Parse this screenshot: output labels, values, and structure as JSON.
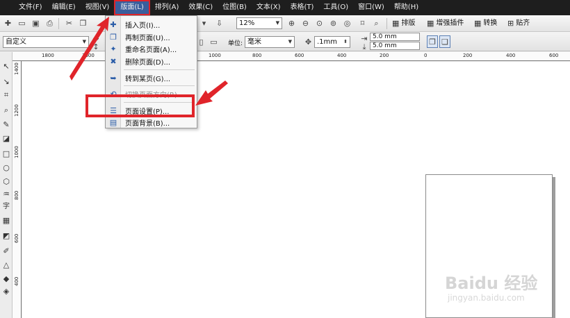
{
  "menubar": {
    "items": [
      {
        "label": "文件(F)"
      },
      {
        "label": "编辑(E)"
      },
      {
        "label": "视图(V)"
      },
      {
        "label": "版面(L)"
      },
      {
        "label": "排列(A)"
      },
      {
        "label": "效果(C)"
      },
      {
        "label": "位图(B)"
      },
      {
        "label": "文本(X)"
      },
      {
        "label": "表格(T)"
      },
      {
        "label": "工具(O)"
      },
      {
        "label": "窗口(W)"
      },
      {
        "label": "帮助(H)"
      }
    ]
  },
  "toolbar1": {
    "zoom_value": "12%",
    "arrange_label": "排版",
    "plugins_label": "增强插件",
    "convert_label": "转换",
    "snap_label": "贴齐"
  },
  "toolbar2": {
    "page_size_value": "自定义",
    "unit_label": "单位:",
    "unit_value": "毫米",
    "nudge_value": ".1mm",
    "dup_x": "5.0 mm",
    "dup_y": "5.0 mm"
  },
  "dropdown": {
    "items": [
      {
        "label": "插入页(I)..."
      },
      {
        "label": "再制页面(U)..."
      },
      {
        "label": "重命名页面(A)..."
      },
      {
        "label": "删除页面(D)..."
      },
      {
        "label": "转到某页(G)..."
      },
      {
        "label": "切换页面方向(R)"
      },
      {
        "label": "页面设置(P)..."
      },
      {
        "label": "页面背景(B)..."
      }
    ]
  },
  "ruler_top": {
    "labels": [
      "1800",
      "1600",
      "1000",
      "800",
      "600",
      "400",
      "200",
      "0",
      "200",
      "400",
      "600"
    ]
  },
  "ruler_left": {
    "labels": [
      "1400",
      "1200",
      "1000",
      "800",
      "600",
      "400"
    ]
  },
  "watermark": {
    "main": "Baidu 经验",
    "sub": "jingyan.baidu.com"
  },
  "colors": {
    "menubar_bg": "#1e1e1e",
    "menu_highlight": "#3a5e9c",
    "annotation_red": "#e0242a"
  }
}
